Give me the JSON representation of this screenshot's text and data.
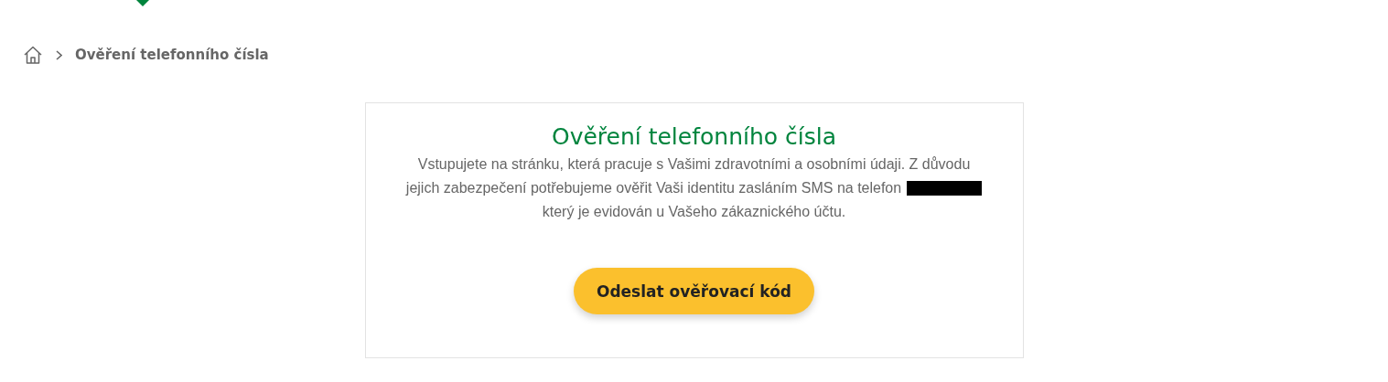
{
  "breadcrumb": {
    "current": "Ověření telefonního čísla"
  },
  "card": {
    "title": "Ověření telefonního čísla",
    "lines": [
      "Vstupujete na stránku, která pracuje s Vašimi zdravotními a osobními údaji. Z důvodu",
      "jejich zabezpečení potřebujeme ověřit Vaši identitu zasláním SMS na telefon",
      "který je evidován u Vašeho zákaznického účtu."
    ],
    "button": "Odeslat ověřovací kód"
  }
}
